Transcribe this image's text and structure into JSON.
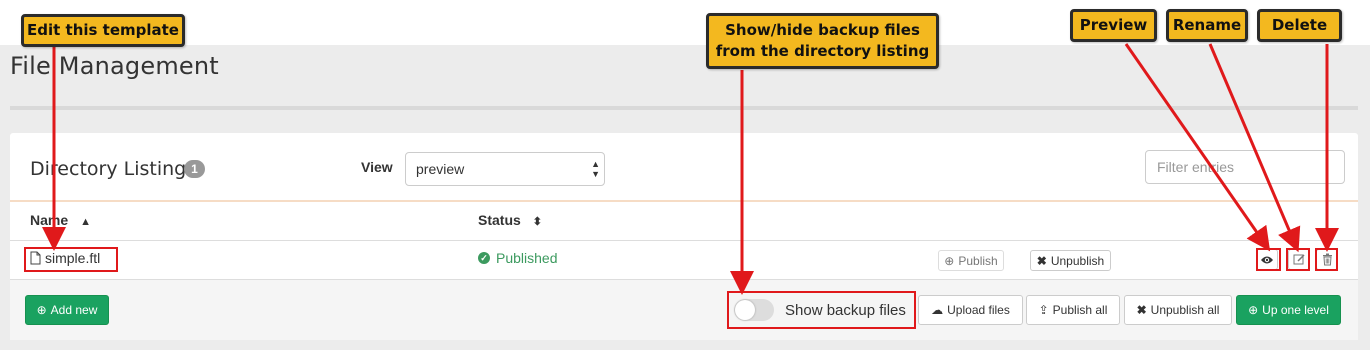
{
  "page": {
    "title": "File Management"
  },
  "directory": {
    "title": "Directory Listing",
    "count": "1"
  },
  "view": {
    "label": "View",
    "selected": "preview"
  },
  "filter": {
    "placeholder": "Filter entries"
  },
  "table": {
    "columns": [
      {
        "label": "Name",
        "sort": "▲"
      },
      {
        "label": "Status",
        "sort": "⬍"
      }
    ],
    "rows": [
      {
        "name": "simple.ftl",
        "status": "Published",
        "actions": {
          "publish": "Publish",
          "unpublish": "Unpublish"
        }
      }
    ]
  },
  "footer": {
    "add_new": "Add new",
    "toggle_label": "Show backup files",
    "upload": "Upload files",
    "publish_all": "Publish all",
    "unpublish_all": "Unpublish all",
    "up_one_level": "Up one level"
  },
  "callouts": {
    "edit": "Edit this template",
    "backup_line1": "Show/hide backup files",
    "backup_line2": "from the directory listing",
    "preview": "Preview",
    "rename": "Rename",
    "delete": "Delete"
  },
  "colors": {
    "accent_green": "#1aa260",
    "status_green": "#3c9a5f",
    "callout": "#f3b81f",
    "highlight_red": "#e0191b"
  },
  "icons": [
    "file-icon",
    "check-circle-icon",
    "eye-icon",
    "edit-icon",
    "trash-icon",
    "publish-icon",
    "x-icon",
    "plus-icon",
    "cloud-upload-icon",
    "upload-icon",
    "up-arrow-icon",
    "sort-icon"
  ]
}
